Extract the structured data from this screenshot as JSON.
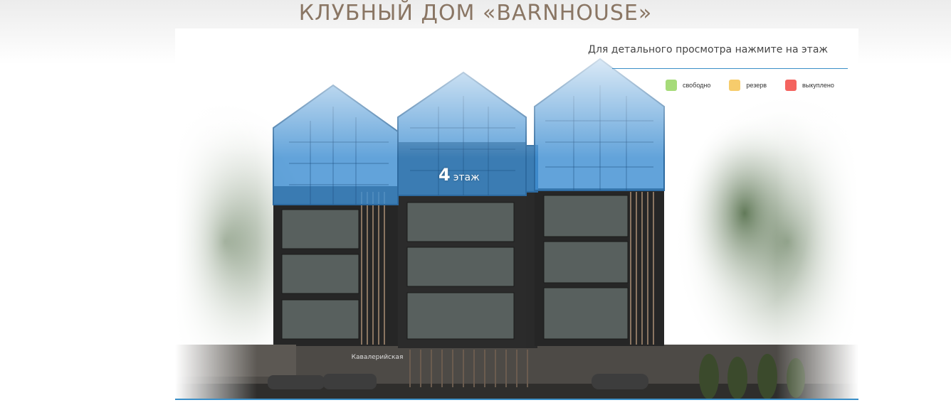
{
  "page": {
    "title": "КЛУБНЫЙ ДОМ «BARNHOUSE»"
  },
  "hint": "Для детального просмотра нажмите на этаж",
  "legend": [
    {
      "label": "свободно",
      "color": "#a6db79"
    },
    {
      "label": "резерв",
      "color": "#f6cc6c"
    },
    {
      "label": "выкуплено",
      "color": "#f4645f"
    }
  ],
  "floor": {
    "number": "4",
    "word": "этаж",
    "highlight_color": "#3f8fd2"
  },
  "building": {
    "street_sign": "Кавалерийская"
  }
}
